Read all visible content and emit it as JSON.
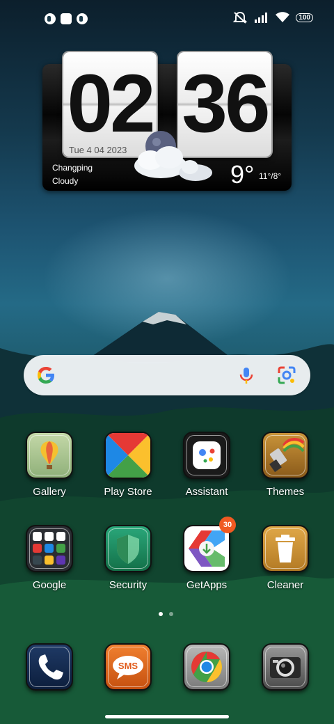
{
  "status_bar": {
    "battery": "100",
    "icons": [
      "app-notification-icon",
      "square-notification-icon",
      "app-notification-icon",
      "mute-icon",
      "signal-icon",
      "wifi-icon"
    ]
  },
  "widget": {
    "hours": "02",
    "minutes": "36",
    "date": "Tue 4 04 2023",
    "city": "Changping",
    "condition": "Cloudy",
    "temp": "9°",
    "range": "11°/8°"
  },
  "search": {
    "logo": "google-g-icon",
    "mic": "mic-icon",
    "lens": "lens-icon"
  },
  "apps_row1": [
    {
      "label": "Gallery"
    },
    {
      "label": "Play Store"
    },
    {
      "label": "Assistant"
    },
    {
      "label": "Themes"
    }
  ],
  "apps_row2": [
    {
      "label": "Google"
    },
    {
      "label": "Security"
    },
    {
      "label": "GetApps",
      "badge": "30"
    },
    {
      "label": "Cleaner"
    }
  ],
  "dock": [
    {
      "name": "phone-icon"
    },
    {
      "name": "sms-icon",
      "text": "SMS"
    },
    {
      "name": "chrome-icon"
    },
    {
      "name": "camera-icon"
    }
  ],
  "page_indicator": {
    "count": 2,
    "active": 0
  }
}
